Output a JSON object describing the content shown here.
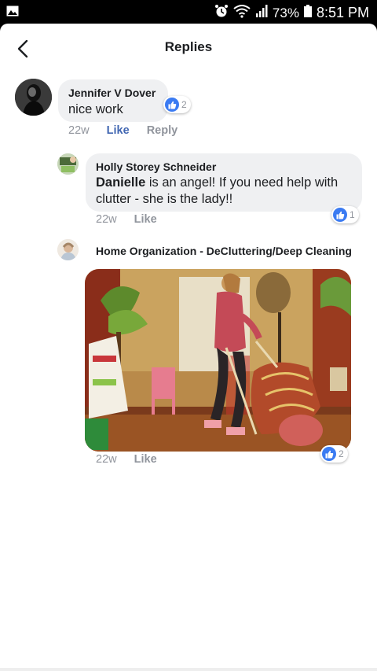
{
  "status_bar": {
    "battery": "73%",
    "time": "8:51 PM",
    "icons": [
      "image-icon",
      "alarm-icon",
      "wifi-icon",
      "signal-icon",
      "battery-icon"
    ]
  },
  "header": {
    "title": "Replies"
  },
  "comments": [
    {
      "author": "Jennifer V Dover",
      "text": "nice work",
      "time": "22w",
      "like_label": "Like",
      "reply_label": "Reply",
      "reactions": "2"
    },
    {
      "author": "Holly Storey Schneider",
      "mention": "Danielle",
      "text": " is an angel! If you need help with clutter - she is the lady!!",
      "time": "22w",
      "like_label": "Like",
      "reactions": "1"
    },
    {
      "author": "Home Organization - DeCluttering/Deep Cleaning",
      "time": "22w",
      "like_label": "Like",
      "reactions": "2"
    }
  ],
  "colors": {
    "accent": "#4267b2",
    "reaction_blue": "#3b7bf2",
    "bubble": "#eff0f2",
    "meta": "#90949c"
  }
}
